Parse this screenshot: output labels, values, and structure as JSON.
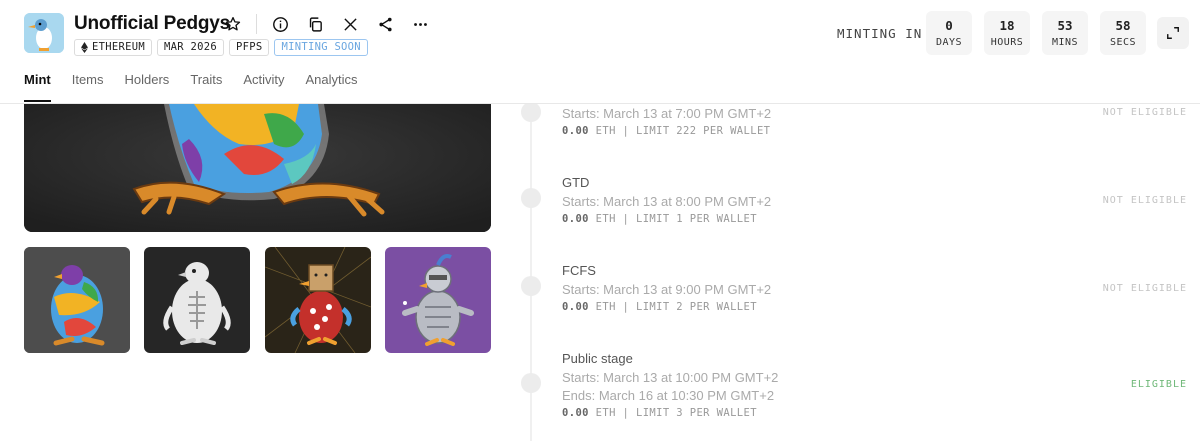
{
  "collection": {
    "title": "Unofficial Pedgys",
    "tags": [
      {
        "label": "ETHEREUM",
        "icon": "ethereum-icon"
      },
      {
        "label": "MAR 2026"
      },
      {
        "label": "PFPS"
      },
      {
        "label": "MINTING SOON"
      }
    ]
  },
  "header_icons": [
    "star-icon",
    "info-icon",
    "copy-icon",
    "x-icon",
    "share-icon",
    "more-icon"
  ],
  "countdown": {
    "label": "MINTING IN",
    "units": [
      {
        "value": "0",
        "label": "DAYS"
      },
      {
        "value": "18",
        "label": "HOURS"
      },
      {
        "value": "53",
        "label": "MINS"
      },
      {
        "value": "58",
        "label": "SECS"
      }
    ]
  },
  "tabs": [
    "Mint",
    "Items",
    "Holders",
    "Traits",
    "Activity",
    "Analytics"
  ],
  "active_tab": "Mint",
  "stages": [
    {
      "name": "",
      "starts": "Starts: March 13 at 7:00 PM GMT+2",
      "ends": "",
      "price": "0.00",
      "currency": "ETH",
      "limit": "LIMIT 222 PER WALLET",
      "eligibility": "NOT ELIGIBLE"
    },
    {
      "name": "GTD",
      "starts": "Starts: March 13 at 8:00 PM GMT+2",
      "ends": "",
      "price": "0.00",
      "currency": "ETH",
      "limit": "LIMIT 1 PER WALLET",
      "eligibility": "NOT ELIGIBLE"
    },
    {
      "name": "FCFS",
      "starts": "Starts: March 13 at 9:00 PM GMT+2",
      "ends": "",
      "price": "0.00",
      "currency": "ETH",
      "limit": "LIMIT 2 PER WALLET",
      "eligibility": "NOT ELIGIBLE"
    },
    {
      "name": "Public stage",
      "starts": "Starts: March 13 at 10:00 PM GMT+2",
      "ends": "Ends: March 16 at 10:30 PM GMT+2",
      "price": "0.00",
      "currency": "ETH",
      "limit": "LIMIT 3 PER WALLET",
      "eligibility": "ELIGIBLE"
    }
  ],
  "colors": {
    "minting_soon": "#6aa6e0",
    "eligible": "#6fb878",
    "not_eligible": "#c4c4c4",
    "thumb_purple": "#7b4fa3"
  }
}
